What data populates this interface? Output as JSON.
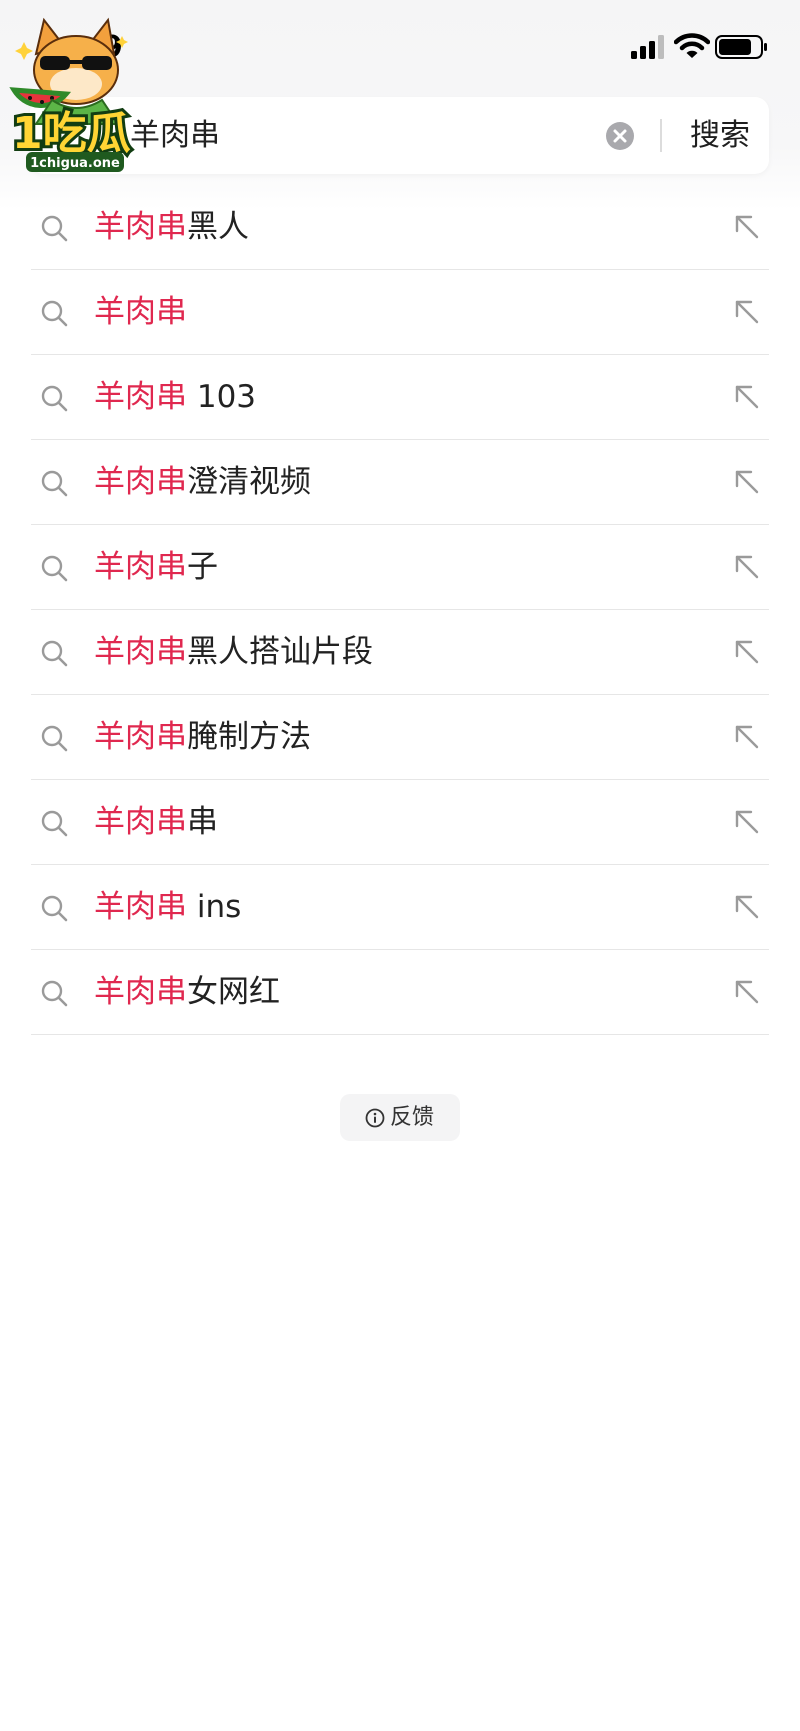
{
  "status_bar": {
    "time": "9",
    "icons": [
      "signal-icon",
      "wifi-icon",
      "battery-icon"
    ]
  },
  "watermark": {
    "text_main": "1吃瓜",
    "text_sub": "1chigua.one"
  },
  "search": {
    "value": "羊肉串",
    "button_label": "搜索",
    "clear_icon": "clear-icon"
  },
  "keyword": "羊肉串",
  "suggestions": [
    {
      "highlight": "羊肉串",
      "rest": "黑人"
    },
    {
      "highlight": "羊肉串",
      "rest": ""
    },
    {
      "highlight": "羊肉串",
      "rest": " 103"
    },
    {
      "highlight": "羊肉串",
      "rest": "澄清视频"
    },
    {
      "highlight": "羊肉串",
      "rest": "子"
    },
    {
      "highlight": "羊肉串",
      "rest": "黑人搭讪片段"
    },
    {
      "highlight": "羊肉串",
      "rest": "腌制方法"
    },
    {
      "highlight": "羊肉串",
      "rest": "串"
    },
    {
      "highlight": "羊肉串",
      "rest": " ins"
    },
    {
      "highlight": "羊肉串",
      "rest": "女网红"
    }
  ],
  "feedback": {
    "label": "反馈",
    "icon": "info-icon"
  },
  "colors": {
    "highlight": "#e0284f",
    "text": "#222222",
    "divider": "#e6e6e6"
  }
}
